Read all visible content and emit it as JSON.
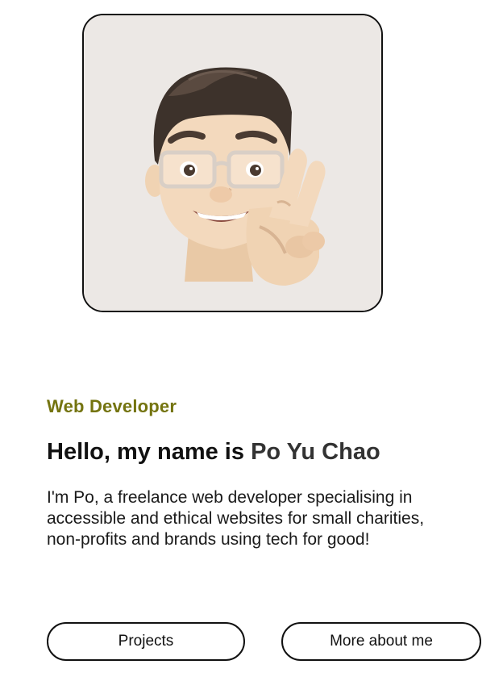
{
  "hero": {
    "avatar_label": "memoji-avatar",
    "role": "Web Developer",
    "greeting": "Hello, my name is",
    "name": "Po Yu Chao",
    "intro": "I'm Po, a freelance web developer specialising in accessible and ethical websites for small charities, non-profits and brands using tech for good!"
  },
  "actions": {
    "projects_label": "Projects",
    "about_label": "More about me"
  },
  "colors": {
    "role_accent": "#747410",
    "avatar_background": "#ece8e5",
    "border": "#111111"
  }
}
